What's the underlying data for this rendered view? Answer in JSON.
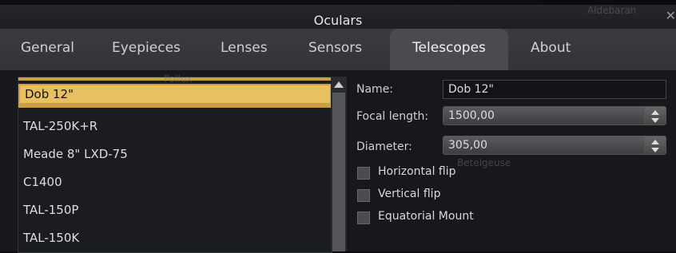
{
  "window": {
    "title": "Oculars",
    "close_glyph": "✕"
  },
  "background_labels": {
    "aldebaran": "Aldebaran",
    "pollux": "Pollux",
    "betelgeuse": "Betelgeuse"
  },
  "tabs": [
    {
      "label": "General"
    },
    {
      "label": "Eyepieces"
    },
    {
      "label": "Lenses"
    },
    {
      "label": "Sensors"
    },
    {
      "label": "Telescopes"
    },
    {
      "label": "About"
    }
  ],
  "telescopes": [
    {
      "label": "Dob 12\""
    },
    {
      "label": "TAL-250K+R"
    },
    {
      "label": "Meade 8\" LXD-75"
    },
    {
      "label": "C1400"
    },
    {
      "label": "TAL-150P"
    },
    {
      "label": "TAL-150K"
    }
  ],
  "form": {
    "name_label": "Name:",
    "name_value": "Dob 12\"",
    "focal_label": "Focal length:",
    "focal_value": "1500,00",
    "diameter_label": "Diameter:",
    "diameter_value": "305,00",
    "hflip_label": "Horizontal flip",
    "vflip_label": "Vertical flip",
    "eq_label": "Equatorial Mount"
  },
  "colors": {
    "selection": "#e8c060",
    "active_tab": "#4a4b50"
  }
}
